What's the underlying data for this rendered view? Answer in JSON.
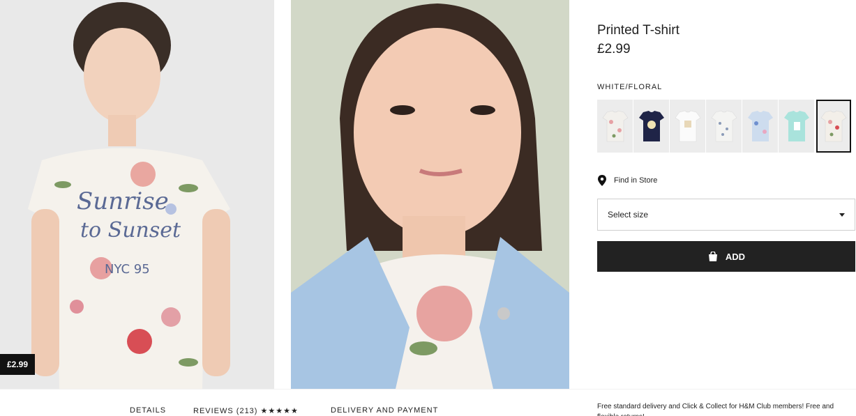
{
  "gallery": {
    "price_tag": "£2.99"
  },
  "product": {
    "name": "Printed T-shirt",
    "price": "£2.99",
    "color_label": "WHITE/FLORAL",
    "swatches": [
      {
        "name": "white-floral-1",
        "color": "#f2f0ec"
      },
      {
        "name": "navy-unicorn",
        "color": "#1f2447"
      },
      {
        "name": "white-print",
        "color": "#fbfbfb"
      },
      {
        "name": "white-butterfly",
        "color": "#f4f4f2"
      },
      {
        "name": "blue-floral",
        "color": "#cddcee"
      },
      {
        "name": "mint-print",
        "color": "#a9e3dc"
      },
      {
        "name": "white-floral-selected",
        "color": "#f3efe9"
      }
    ],
    "find_in_store": "Find in Store",
    "size_placeholder": "Select size",
    "add_label": "ADD"
  },
  "tabs": {
    "details": "DETAILS",
    "reviews": "REVIEWS (213)",
    "reviews_stars": "★★★★★",
    "delivery": "DELIVERY AND PAYMENT"
  },
  "promo": {
    "text": "Free standard delivery and Click & Collect for H&M Club members! Free and flexible returns!"
  },
  "colors": {
    "accent": "#222222",
    "tag_bg": "#111111"
  }
}
